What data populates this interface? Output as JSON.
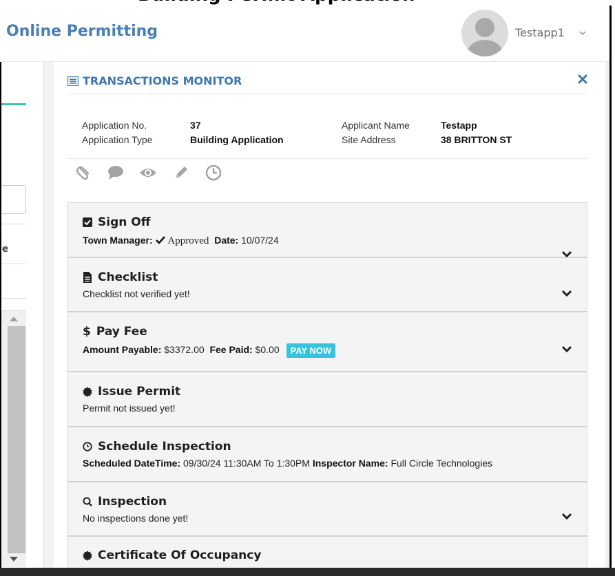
{
  "page_header": {
    "cut_off_title": "Building Permit Application"
  },
  "header": {
    "brand": "Online Permitting",
    "user": {
      "name": "Testapp1"
    }
  },
  "modal": {
    "title": "TRANSACTIONS MONITOR",
    "info": {
      "application_no_label": "Application No.",
      "application_no": "37",
      "application_type_label": "Application Type",
      "application_type": "Building Application",
      "applicant_name_label": "Applicant Name",
      "applicant_name": "Testapp",
      "site_address_label": "Site Address",
      "site_address": "38 BRITTON ST"
    },
    "toolbar_icons": [
      "paperclip-icon",
      "comment-icon",
      "eye-icon",
      "pencil-icon",
      "clock-icon"
    ],
    "sections": {
      "sign_off": {
        "title": "Sign Off",
        "manager_label": "Town Manager:",
        "status": "Approved",
        "date_label": "Date:",
        "date": "10/07/24"
      },
      "checklist": {
        "title": "Checklist",
        "text": "Checklist not verified yet!"
      },
      "pay_fee": {
        "title": "Pay Fee",
        "icon": "$",
        "amount_label": "Amount Payable:",
        "amount": "$3372.00",
        "paid_label": "Fee Paid:",
        "paid": "$0.00",
        "button": "PAY NOW",
        "button_color": "#36c4dc"
      },
      "issue_permit": {
        "title": "Issue Permit",
        "text": "Permit not issued yet!"
      },
      "schedule_inspection": {
        "title": "Schedule Inspection",
        "datetime_label": "Scheduled DateTime:",
        "datetime": "09/30/24 11:30AM To 1:30PM",
        "inspector_label": "Inspector Name:",
        "inspector": "Full Circle Technologies"
      },
      "inspection": {
        "title": "Inspection",
        "text": "No inspections done yet!"
      },
      "certificate": {
        "title": "Certificate Of Occupancy"
      }
    }
  },
  "colors": {
    "brand": "#4a7fb5",
    "accent_teal": "#3bbfb1",
    "title_blue": "#3f77ad"
  }
}
